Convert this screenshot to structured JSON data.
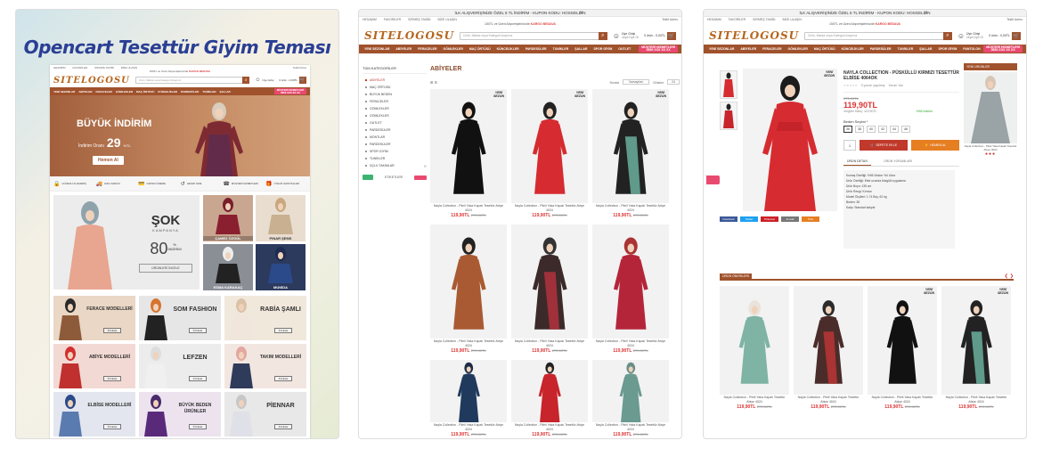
{
  "colors": {
    "brand": "#a0522d",
    "accent": "#e84a6f",
    "price": "#d33333",
    "banner_title": "#2a3f94"
  },
  "common": {
    "top_bar": "İLK ALIŞVERİŞİNİZE ÖZEL 5 TL İNDİRİM - KUPON KODU: HOSGELDIN",
    "promo": "150TL ve Üzeri Alışverişlerinizde",
    "promo_bold": "KARGO BEDAVA",
    "nav_links": [
      "HESABIM",
      "FAVORİLER",
      "SİPARİŞ TAKİBİ",
      "BİZE ULAŞIN"
    ],
    "nav_right": "Teklif Adres",
    "logo": "SITELOGOSU",
    "search_placeholder": "Ürün, Marka veya Kategori Arayınız",
    "account_label": "Üye Girişi",
    "account_sub": "veya Üye Ol",
    "cart_label": "0 ürün - 0,00TL",
    "menu_items": [
      "YENİ SEZONLAR",
      "ABİYELER",
      "FERACELER",
      "GÖMLEKLER",
      "MAÇ ÖRTÜSÜ",
      "KÜNCELİKLER",
      "PARDESÜLER",
      "TUNİKLER",
      "ŞALLAR",
      "SPOR GİYİM",
      "PANTOLON",
      "OUTLET"
    ],
    "call_label": "MÜŞTERİ HİZMETLERİ",
    "call_number": "0850 XXX XX XX",
    "product_name": "Nayla Collection - Pileli Yaka Kapalı Tesettür Abiye 4024",
    "price_new": "119,90TL",
    "price_old": "270,00TL",
    "new_badge_1": "YENİ",
    "new_badge_2": "SEZON"
  },
  "panel1": {
    "title": "Opencart Tesettür Giyim Teması",
    "hero_title": "BÜYÜK İNDİRİM",
    "hero_sub": "İndirim Oranı",
    "hero_pct": "29",
    "hero_pct_suffix": "%TL",
    "hero_btn": "Hemen Al",
    "features": [
      "GÜVENLİ ALIŞVERİŞ",
      "HIZLI KARGO",
      "KAPIDA ÖDEME",
      "HESAP İADE",
      "MÜŞTERİ HİZMETLERİ",
      "ÜYELİK AVANTAJLARI"
    ],
    "sale_big": "ŞOK",
    "sale_small": "KAMPANYA",
    "sale_pct": "80",
    "sale_pct_suffix": "%",
    "sale_pct_word": "İNDİRİM",
    "sale_btn": "ÜRÜNLERİ İNCELE",
    "small_tiles": [
      "ÇAMEZ ÖZGÜL",
      "PINAR ŞEMS",
      "ESMA KARAKAÇ",
      "MUNİDA"
    ],
    "categories": [
      {
        "label": "FERACE MODELLERİ",
        "btn": "İNCELE"
      },
      {
        "label": "SOM FASHION",
        "btn": "İNCELE"
      },
      {
        "label": "RABİA ŞAMLI",
        "btn": "İNCELE"
      },
      {
        "label": "ABİYE MODELLERİ",
        "btn": "İNCELE"
      },
      {
        "label": "LEFZEN",
        "btn": "İNCELE"
      },
      {
        "label": "TAKIM MODELLERİ",
        "btn": "İNCELE"
      },
      {
        "label": "ELBİSE MODELLERİ",
        "btn": "İNCELE"
      },
      {
        "label": "BÜYÜK BEDEN ÜRÜNLER",
        "btn": "İNCELE"
      },
      {
        "label": "PİENNAR",
        "btn": "İNCELE"
      }
    ]
  },
  "panel2": {
    "sidebar_title": "TÜM KATEGORİLER",
    "sidebar_items": [
      "ABİYELER",
      "MAÇ ÖRTÜSÜ",
      "BÜYÜK BEDEN",
      "FERACELER",
      "GÖMLEKLER",
      "GÖMLEKLER",
      "OUTLET",
      "PARDESÜLER",
      "MONTLAR",
      "PARDESÜLER",
      "SPOR GİYİM",
      "TUNİKLER",
      "ÜÇLÜ TAKIMLAR"
    ],
    "sidebar_extra": "ETİKETLERİ",
    "page_heading": "ABİYELER",
    "grid_label": "⊞ ☰",
    "sort_label": "Sırala",
    "sort_value": "Varsayılan",
    "show_label": "Göster",
    "show_value": "24"
  },
  "panel3": {
    "product_title": "NAYLA COLLECTION - PÜSKÜLLÜ KIRMIZI TESETTÜR ELBİSE 4064OK",
    "reviews": "0 yorum yapılmış",
    "write_review": "Yorum Yaz",
    "old_price": "270,00TL",
    "new_price": "119,90TL",
    "tax": "Vergiler Hariç: 119,90TL",
    "discount": "%56 İndirim",
    "size_label": "Beden Seçimi *",
    "sizes": [
      "36",
      "38",
      "40",
      "42",
      "44",
      "46"
    ],
    "qty": "1",
    "add_cart": "SEPETE EKLE",
    "buy_now": "HEMEN AL",
    "tab1": "ÜRÜN DETAYI",
    "tab2": "ÜRÜN YORUMLARI",
    "spec_lines": [
      "Kumaş Özelliği: %96 Viskon %4 Likra",
      "Ürün Özelliği: Etek ucunda büzgülü uygulama",
      "Ürün Boyu: 135 cm",
      "Ürün Rengi: Kırmızı",
      "Model Ölçüleri: 1.74 Boy, 62 kg",
      "Beden: 38",
      "Kalıp: Standart kalıptır"
    ],
    "share": [
      "Facebook",
      "Twitter",
      "Pinterest",
      "E-mail",
      "Print"
    ],
    "side_title": "YENİ ÜRÜNLER",
    "related_title": "ÜRÜN ÖNERİLERİ"
  }
}
